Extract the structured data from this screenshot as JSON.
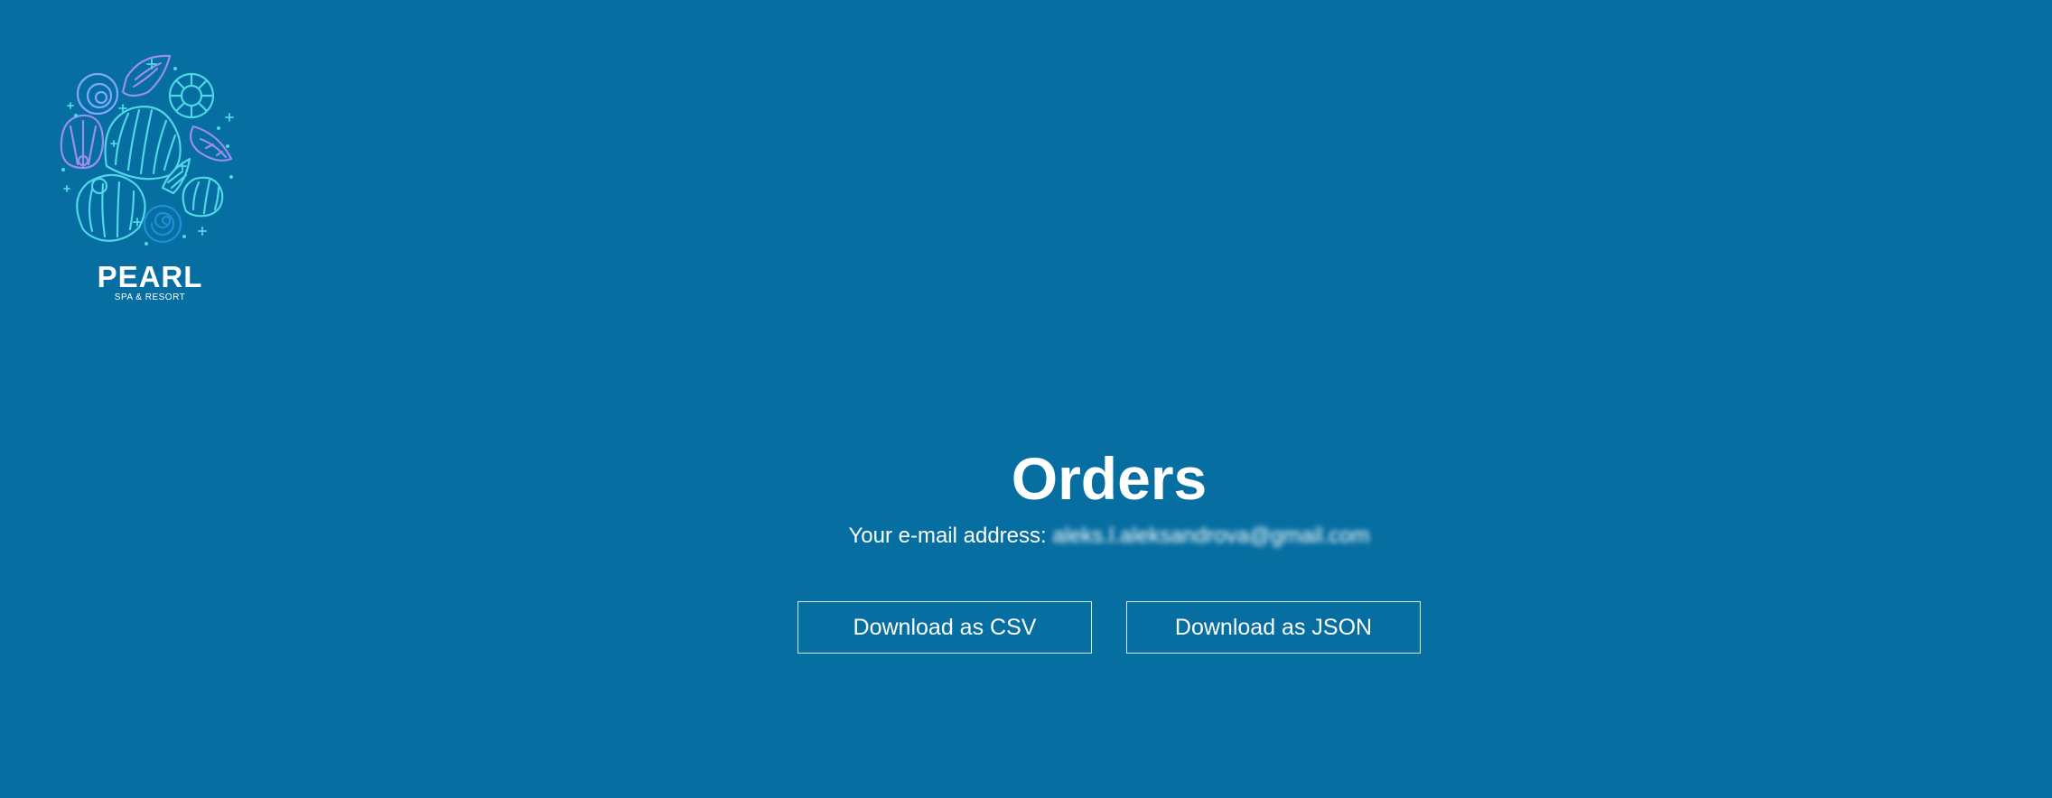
{
  "brand": {
    "name": "PEARL",
    "tagline": "SPA & RESORT"
  },
  "page": {
    "title": "Orders",
    "email_label": "Your e-mail address:",
    "email_value": "aleks.l.aleksandrova@gmail.com"
  },
  "actions": {
    "csv_label": "Download as CSV",
    "json_label": "Download as JSON"
  },
  "colors": {
    "background": "#066ea1",
    "text": "#ffffff",
    "logo_shell_cyan": "#4fd7e6",
    "logo_shell_purple": "#9b8df0"
  }
}
